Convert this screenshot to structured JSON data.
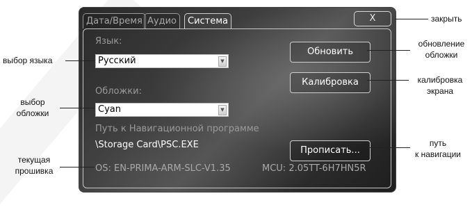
{
  "tabs": [
    {
      "label": "Дата/Время",
      "active": false
    },
    {
      "label": "Аудио",
      "active": false
    },
    {
      "label": "Система",
      "active": true
    }
  ],
  "close_button": {
    "label": "X"
  },
  "language": {
    "label": "Язык:",
    "selected": "Русский"
  },
  "skin": {
    "label": "Обложки:",
    "selected": "Cyan"
  },
  "nav_path": {
    "label": "Путь к Навигационной программе",
    "value": "\\Storage Card\\PSC.EXE"
  },
  "buttons": {
    "update": "Обновить",
    "calibrate": "Калибровка",
    "assign": "Прописать..."
  },
  "firmware": {
    "os": "OS: EN-PRIMA-ARM-SLC-V1.35",
    "mcu": "MCU: 2.05TT-6H7HN5R"
  },
  "callouts": {
    "close": "закрыть",
    "update_skin": [
      "обновление",
      "обложки"
    ],
    "calibrate_screen": [
      "калибровка",
      "экрана"
    ],
    "nav_path": [
      "путь",
      "к навигации"
    ],
    "language_select": "выбор языка",
    "skin_select": [
      "выбор",
      "обложки"
    ],
    "current_firmware": [
      "текущая",
      "прошивка"
    ]
  }
}
